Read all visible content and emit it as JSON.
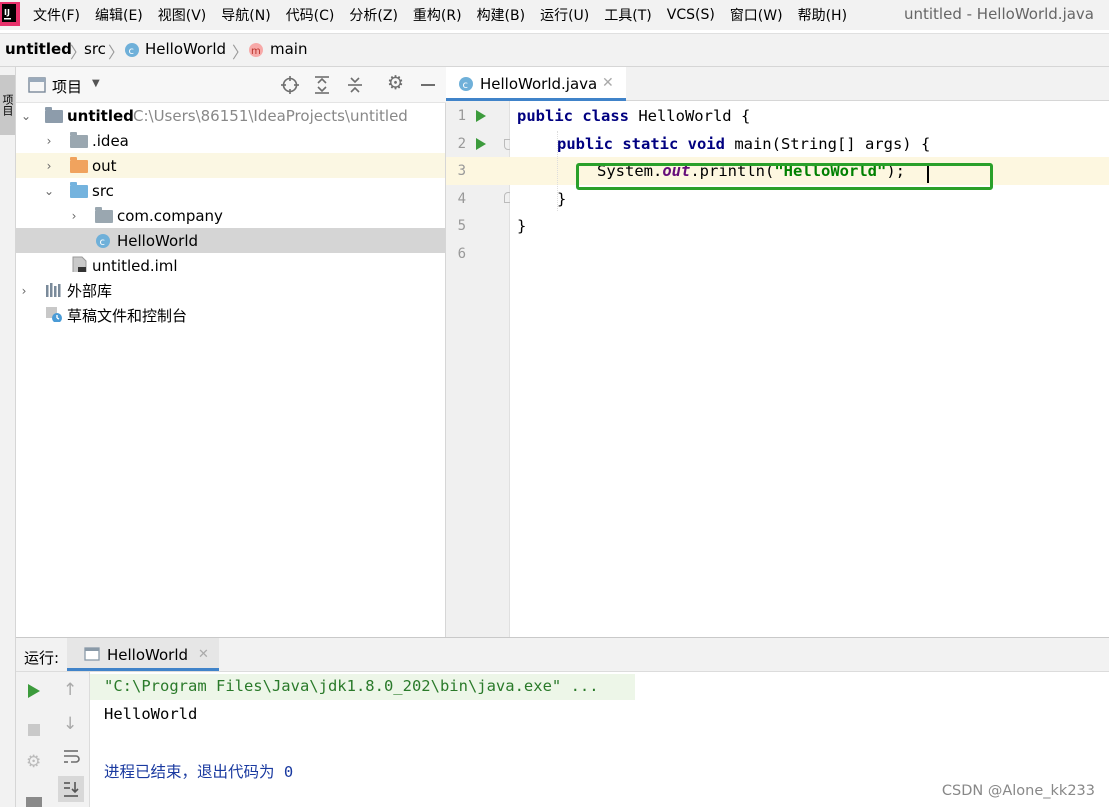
{
  "menu": {
    "items": [
      "文件(F)",
      "编辑(E)",
      "视图(V)",
      "导航(N)",
      "代码(C)",
      "分析(Z)",
      "重构(R)",
      "构建(B)",
      "运行(U)",
      "工具(T)",
      "VCS(S)",
      "窗口(W)",
      "帮助(H)"
    ],
    "window_title": "untitled - HelloWorld.java"
  },
  "breadcrumb": {
    "project": "untitled",
    "folder": "src",
    "class": "HelloWorld",
    "method": "main"
  },
  "left_strip": {
    "tab_label": "项目"
  },
  "project_panel": {
    "title": "项目",
    "tree": [
      {
        "label": "untitled",
        "path": "C:\\Users\\86151\\IdeaProjects\\untitled"
      },
      {
        "label": ".idea"
      },
      {
        "label": "out"
      },
      {
        "label": "src"
      },
      {
        "label": "com.company"
      },
      {
        "label": "HelloWorld"
      },
      {
        "label": "untitled.iml"
      },
      {
        "label": "外部库"
      },
      {
        "label": "草稿文件和控制台"
      }
    ]
  },
  "editor": {
    "tab_label": "HelloWorld.java",
    "line_numbers": [
      "1",
      "2",
      "3",
      "4",
      "5",
      "6"
    ],
    "code": {
      "l1_kw": "public class",
      "l1_rest": " HelloWorld {",
      "l2_kw": "public static void",
      "l2_rest": " main(String[] args) {",
      "l3_a": "System.",
      "l3_field": "out",
      "l3_b": ".println(",
      "l3_str": "\"HelloWorld\"",
      "l3_c": ");",
      "l4": "}",
      "l5": "}"
    },
    "highlight_color": "#2aa02a"
  },
  "run_panel": {
    "label": "运行:",
    "tab_label": "HelloWorld",
    "console": [
      "\"C:\\Program Files\\Java\\jdk1.8.0_202\\bin\\java.exe\" ...",
      "HelloWorld",
      "进程已结束，退出代码为 0"
    ]
  },
  "watermark": "CSDN @Alone_kk233"
}
